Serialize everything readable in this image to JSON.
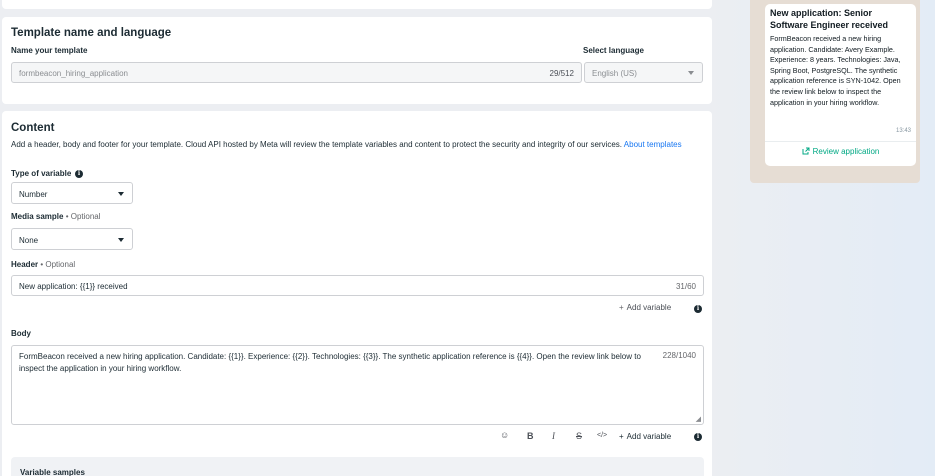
{
  "template_section": {
    "title": "Template name and language",
    "name_label": "Name your template",
    "name_value": "formbeacon_hiring_application",
    "name_counter": "29/512",
    "language_label": "Select language",
    "language_value": "English (US)"
  },
  "content": {
    "title": "Content",
    "description": "Add a header, body and footer for your template. Cloud API hosted by Meta will review the template variables and content to protect the security and integrity of our services.",
    "about_link": "About templates",
    "variable_type_label": "Type of variable",
    "variable_type_value": "Number",
    "media_label": "Media sample",
    "media_optional": "• Optional",
    "media_value": "None",
    "header_label": "Header",
    "header_optional": "• Optional",
    "header_value": "New application: {{1}} received",
    "header_counter": "31/60",
    "add_variable_label": "Add variable",
    "body_label": "Body",
    "body_value": "FormBeacon received a new hiring application. Candidate: {{1}}. Experience: {{2}}. Technologies: {{3}}. The synthetic application reference is {{4}}. Open the review link below to inspect the application in your hiring workflow.",
    "body_counter": "228/1040",
    "toolbar": {
      "emoji_icon": "☺",
      "bold_icon": "B",
      "italic_icon": "I",
      "strike_icon": "S",
      "code_icon": "</>",
      "add_variable_label": "Add variable"
    },
    "variable_samples_label": "Variable samples"
  },
  "preview": {
    "title": "New application: Senior Software Engineer received",
    "body": "FormBeacon received a new hiring application. Candidate: Avery Example. Experience: 8 years. Technologies: Java, Spring Boot, PostgreSQL. The synthetic application reference is SYN-1042. Open the review link below to inspect the application in your hiring workflow.",
    "time": "13:43",
    "button_label": "Review application"
  },
  "colors": {
    "accent": "#1877f2",
    "preview_button": "#00a884",
    "preview_bg": "#e6ddd4"
  }
}
